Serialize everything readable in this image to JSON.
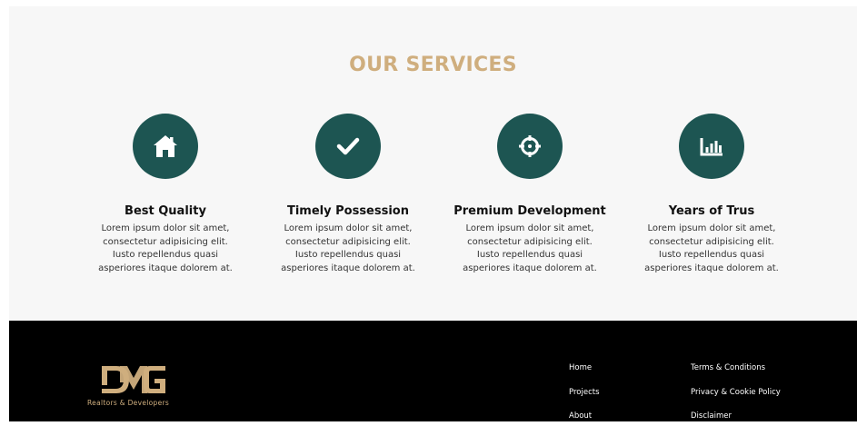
{
  "services": {
    "title": "OUR SERVICES",
    "items": [
      {
        "icon": "home-icon",
        "title": "Best Quality",
        "desc": [
          "Lorem ipsum dolor sit amet,",
          "consectetur adipisicing elit.",
          "Iusto repellendus quasi",
          "asperiores itaque dolorem at."
        ]
      },
      {
        "icon": "check-icon",
        "title": "Timely Possession",
        "desc": [
          "Lorem ipsum dolor sit amet,",
          "consectetur adipisicing elit.",
          "Iusto repellendus quasi",
          "asperiores itaque dolorem at."
        ]
      },
      {
        "icon": "crosshair-icon",
        "title": "Premium Development",
        "desc": [
          "Lorem ipsum dolor sit amet,",
          "consectetur adipisicing elit.",
          "Iusto repellendus quasi",
          "asperiores itaque dolorem at."
        ]
      },
      {
        "icon": "chart-bar-icon",
        "title": "Years of Trus",
        "desc": [
          "Lorem ipsum dolor sit amet,",
          "consectetur adipisicing elit.",
          "Iusto repellendus quasi",
          "asperiores itaque dolorem at."
        ]
      }
    ]
  },
  "footer": {
    "logo_text": "Realtors & Developers",
    "links_col1": [
      "Home",
      "Projects",
      "About"
    ],
    "links_col2": [
      "Terms & Conditions",
      "Privacy & Cookie Policy",
      "Disclaimer"
    ]
  },
  "colors": {
    "accent": "#cfae7e",
    "icon_bg": "#1d5552",
    "footer_bg": "#000000",
    "section_bg": "#f7f7f7"
  }
}
